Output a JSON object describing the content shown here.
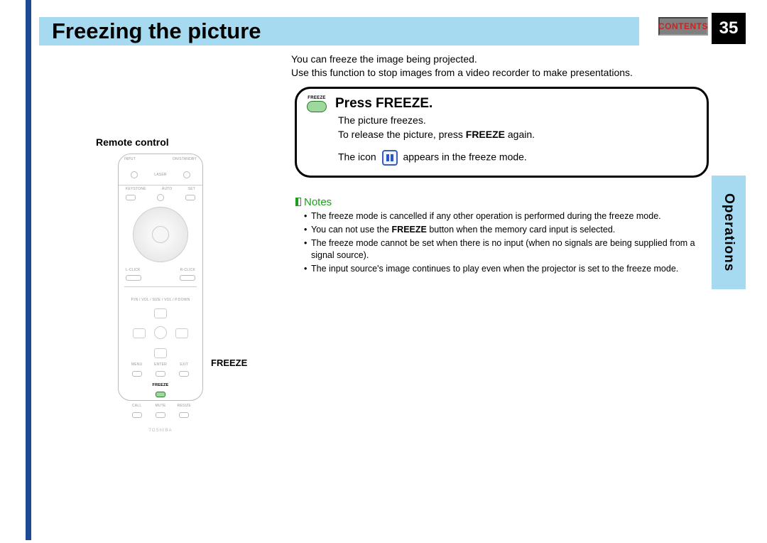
{
  "header": {
    "title": "Freezing the picture",
    "contents_label": "CONTENTS",
    "page_number": "35",
    "side_tab": "Operations"
  },
  "intro": {
    "line1": "You can freeze the image being projected.",
    "line2": "Use this function to stop images from a video recorder to make presentations."
  },
  "instruction": {
    "key_label": "FREEZE",
    "heading": "Press FREEZE.",
    "line1": "The picture freezes.",
    "line2_pre": "To release the picture, press ",
    "line2_bold": "FREEZE",
    "line2_post": " again.",
    "line3_pre": "The icon ",
    "line3_post": " appears in the freeze mode."
  },
  "notes": {
    "heading": "Notes",
    "items": [
      {
        "text_pre": "The freeze mode is cancelled if any other operation is performed during the freeze mode.",
        "bold": "",
        "text_post": ""
      },
      {
        "text_pre": "You can not use the ",
        "bold": "FREEZE",
        "text_post": " button when the memory card input is selected."
      },
      {
        "text_pre": "The freeze mode cannot be set when there is no input (when no signals are being supplied from a signal source).",
        "bold": "",
        "text_post": ""
      },
      {
        "text_pre": "The input source's image continues to play even when the projector is set to the freeze mode.",
        "bold": "",
        "text_post": ""
      }
    ]
  },
  "remote": {
    "title": "Remote control",
    "buttons": {
      "input": "INPUT",
      "onstandby": "ON/STANDBY",
      "laser": "LASER",
      "keystone": "KEYSTONE",
      "auto": "AUTO",
      "set": "SET",
      "lclick": "L-CLICK",
      "rclick": "R-CLICK",
      "p_text": "P.IN / VOL / SIZE / VOL / P.DOWN",
      "menu": "MENU",
      "enter": "ENTER",
      "exit": "EXIT",
      "freeze": "FREEZE",
      "call": "CALL",
      "mute": "MUTE",
      "resize": "RESIZE",
      "brand": "TOSHIBA"
    },
    "callout": "FREEZE"
  }
}
